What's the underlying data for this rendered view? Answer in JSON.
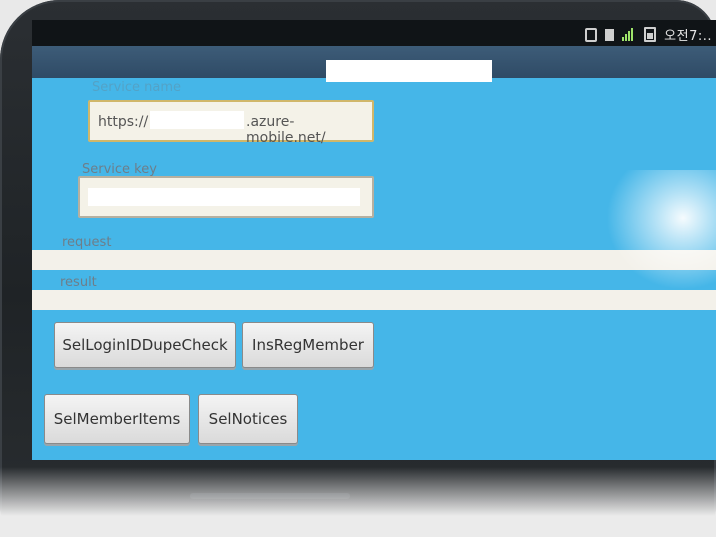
{
  "status_bar": {
    "clock": "오전7:..",
    "icons": [
      "sim-icon",
      "document-icon",
      "signal-icon",
      "battery-icon"
    ]
  },
  "app": {
    "title": ""
  },
  "form": {
    "server_label": "Service name",
    "server_url_prefix": "https://",
    "server_url_suffix": ".azure-mobile.net/",
    "service_key_label": "Service key",
    "request_label": "request",
    "result_label": "result"
  },
  "buttons": {
    "sel_login_id_dupe_check": "SelLoginIDDupeCheck",
    "ins_reg_member": "InsRegMember",
    "sel_member_items": "SelMemberItems",
    "sel_notices": "SelNotices"
  },
  "colors": {
    "screen_bg": "#45b6e8",
    "titlebar": "#2f4b66",
    "status_bar": "#101417"
  }
}
